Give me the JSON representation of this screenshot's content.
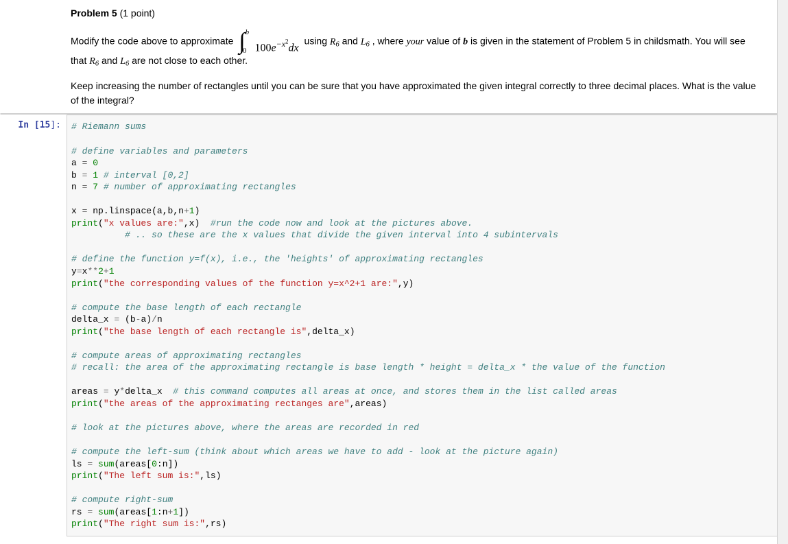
{
  "markdown": {
    "title_bold": "Problem 5",
    "title_points": " (1 point)",
    "line1_pre": "Modify the code above to approximate ",
    "integral": {
      "lower": "0",
      "upper": "b",
      "coeff": "100",
      "base": "e",
      "exponent": "−x",
      "exponent_sup": "2",
      "dx": "dx"
    },
    "line1_mid1": "  using ",
    "R6_R": "R",
    "R6_6": "6",
    "line1_and": " and ",
    "L6_L": "L",
    "L6_6": "6",
    "line1_mid2": ", where ",
    "your": "your",
    "line1_mid3": " value of ",
    "b": "b",
    "line1_end": " is given in the statement of Problem 5 in childsmath. You will see that ",
    "line1_end2": " are not close to each other.",
    "line2": "Keep increasing the number of rectangles until you can be sure that you have approximated the given integral correctly to three decimal places. What is the value of the integral?"
  },
  "code": {
    "prompt_in": "In [",
    "prompt_num": "15",
    "prompt_close": "]:",
    "lines": [
      {
        "t": "c",
        "v": "# Riemann sums"
      },
      {
        "t": "blank",
        "v": ""
      },
      {
        "t": "c",
        "v": "# define variables and parameters"
      },
      {
        "t": "assign",
        "lhs": "a",
        "op": " = ",
        "rhs": "0"
      },
      {
        "t": "assign_c",
        "lhs": "b",
        "op": " = ",
        "rhs": "1",
        "cmt": " # interval [0,2]"
      },
      {
        "t": "assign_c",
        "lhs": "n",
        "op": " = ",
        "rhs": "7",
        "cmt": " # number of approximating rectangles"
      },
      {
        "t": "blank",
        "v": ""
      },
      {
        "t": "raw",
        "v": "x = np.linspace(a,b,n+1)"
      },
      {
        "t": "print_c",
        "fn": "print",
        "args": "\"x values are:\",x",
        "cmt": "  #run the code now and look at the pictures above."
      },
      {
        "t": "c_indent",
        "v": "          # .. so these are the x values that divide the given interval into 4 subintervals"
      },
      {
        "t": "blank",
        "v": ""
      },
      {
        "t": "c",
        "v": "# define the function y=f(x), i.e., the 'heights' of approximating rectangles"
      },
      {
        "t": "raw",
        "v": "y=x**2+1"
      },
      {
        "t": "print",
        "fn": "print",
        "args": "\"the corresponding values of the function y=x^2+1 are:\",y"
      },
      {
        "t": "blank",
        "v": ""
      },
      {
        "t": "c",
        "v": "# compute the base length of each rectangle"
      },
      {
        "t": "raw",
        "v": "delta_x = (b-a)/n"
      },
      {
        "t": "print",
        "fn": "print",
        "args": "\"the base length of each rectangle is\",delta_x"
      },
      {
        "t": "blank",
        "v": ""
      },
      {
        "t": "c",
        "v": "# compute areas of approximating rectangles"
      },
      {
        "t": "c",
        "v": "# recall: the area of the approximating rectangle is base length * height = delta_x * the value of the function"
      },
      {
        "t": "blank",
        "v": ""
      },
      {
        "t": "raw_c",
        "v": "areas = y*delta_x",
        "cmt": "  # this command computes all areas at once, and stores them in the list called areas"
      },
      {
        "t": "print",
        "fn": "print",
        "args": "\"the areas of the approximating rectanges are\",areas"
      },
      {
        "t": "blank",
        "v": ""
      },
      {
        "t": "c",
        "v": "# look at the pictures above, where the areas are recorded in red"
      },
      {
        "t": "blank",
        "v": ""
      },
      {
        "t": "c",
        "v": "# compute the left-sum (think about which areas we have to add - look at the picture again)"
      },
      {
        "t": "raw",
        "v": "ls = sum(areas[0:n])"
      },
      {
        "t": "print",
        "fn": "print",
        "args": "\"The left sum is:\",ls"
      },
      {
        "t": "blank",
        "v": ""
      },
      {
        "t": "c",
        "v": "# compute right-sum"
      },
      {
        "t": "raw",
        "v": "rs = sum(areas[1:n+1])"
      },
      {
        "t": "print",
        "fn": "print",
        "args": "\"The right sum is:\",rs"
      }
    ]
  }
}
